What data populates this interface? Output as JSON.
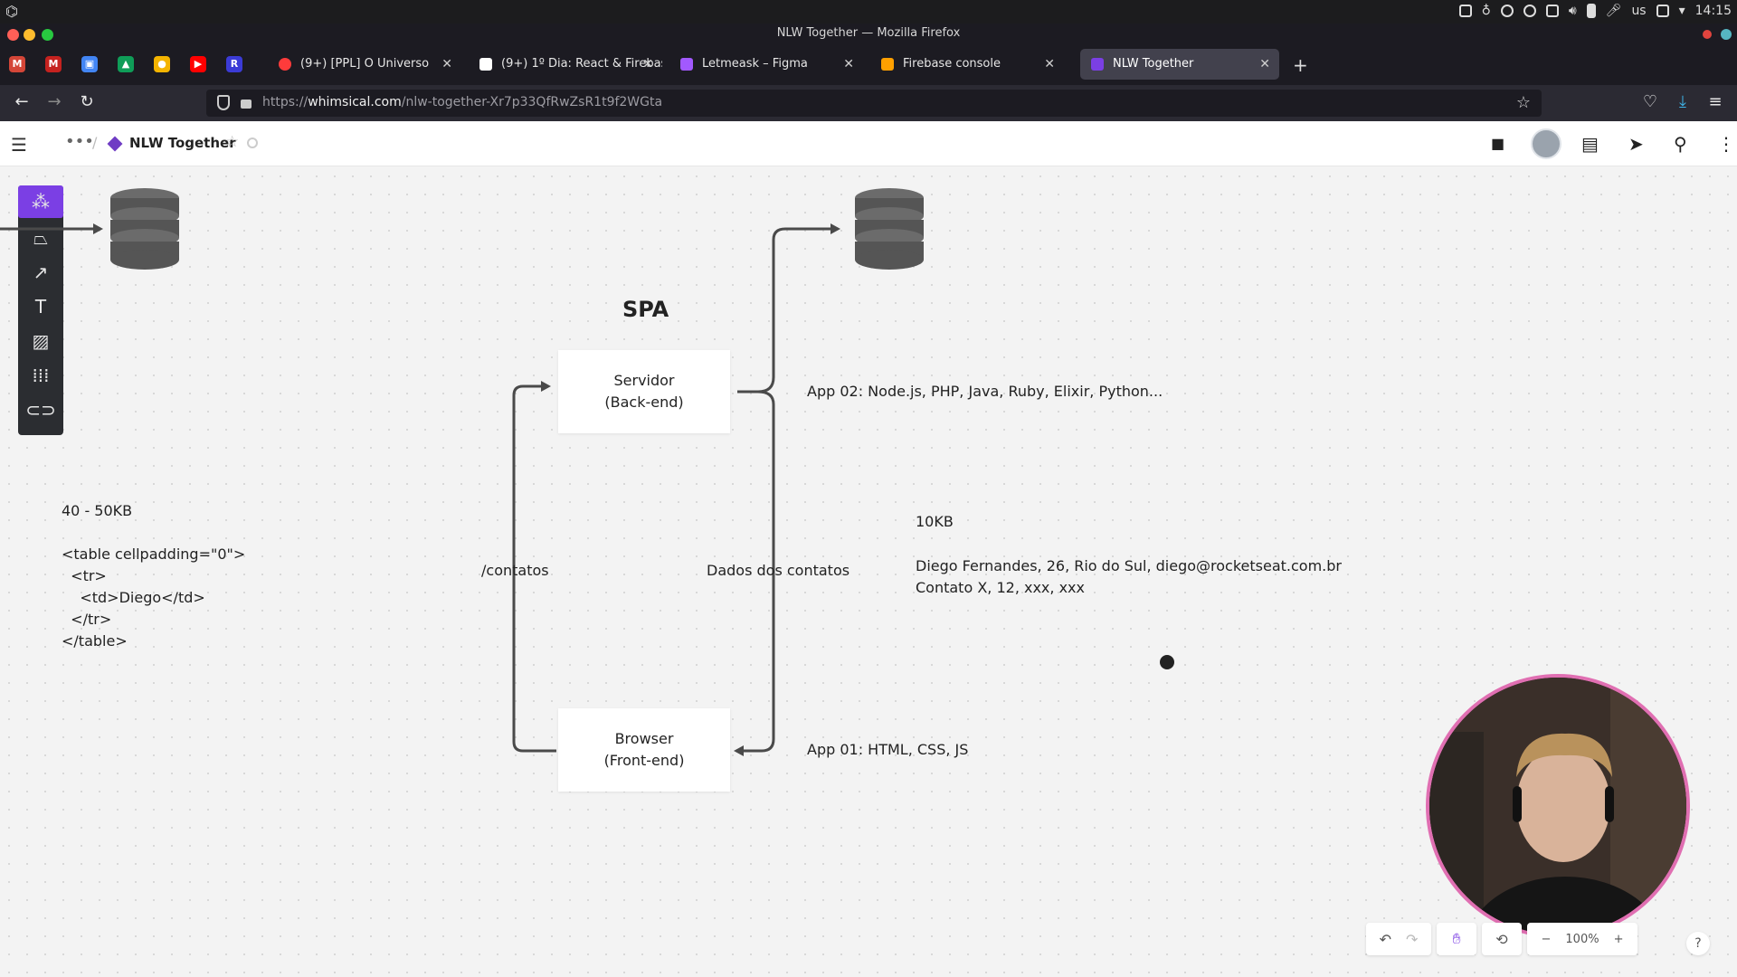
{
  "os": {
    "keyboard": "us",
    "clock": "14:15"
  },
  "browser": {
    "window_title": "NLW Together — Mozilla Firefox",
    "tabs": [
      {
        "label": "(9+) [PPL] O Universo",
        "favicon": "youtube-icon",
        "active": false
      },
      {
        "label": "(9+) 1º Dia: React & Firebas",
        "favicon": "notion-icon",
        "active": false
      },
      {
        "label": "Letmeask – Figma",
        "favicon": "figma-icon",
        "active": false
      },
      {
        "label": "Firebase console",
        "favicon": "firebase-icon",
        "active": false
      },
      {
        "label": "NLW Together",
        "favicon": "whimsical-icon",
        "active": true
      }
    ],
    "url_prefix": "https://",
    "url_domain": "whimsical.com",
    "url_path": "/nlw-together-Xr7p33QfRwZsR1t9f2WGta"
  },
  "app": {
    "board_title": "NLW Together",
    "accent": "#7b3fe4"
  },
  "diagram": {
    "title": "SPA",
    "server_box": {
      "line1": "Servidor",
      "line2": "(Back-end)"
    },
    "browser_box": {
      "line1": "Browser",
      "line2": "(Front-end)"
    },
    "edge_request": "/contatos",
    "edge_response": "Dados dos contatos",
    "app02_note": "App 02: Node.js, PHP, Java, Ruby, Elixir, Python...",
    "app01_note": "App 01: HTML, CSS, JS",
    "size_right": "10KB",
    "data_line1": "Diego Fernandes, 26, Rio do Sul, diego@rocketseat.com.br",
    "data_line2": "Contato X, 12, xxx, xxx",
    "size_left": "40 - 50KB",
    "html_code": "<table cellpadding=\"0\">\n  <tr>\n    <td>Diego</td>\n  </tr>\n</table>"
  },
  "zoom": "100%",
  "help_label": "?"
}
